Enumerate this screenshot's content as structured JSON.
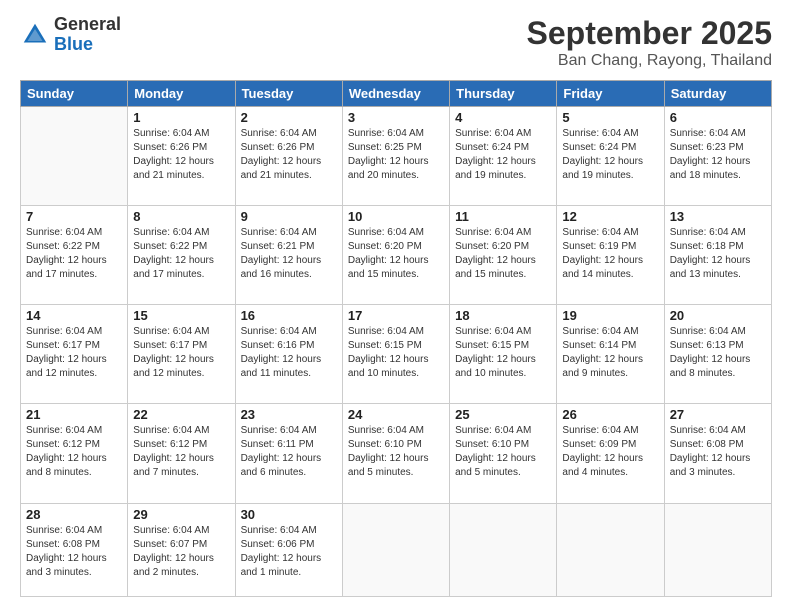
{
  "header": {
    "logo_general": "General",
    "logo_blue": "Blue",
    "title": "September 2025",
    "subtitle": "Ban Chang, Rayong, Thailand"
  },
  "weekdays": [
    "Sunday",
    "Monday",
    "Tuesday",
    "Wednesday",
    "Thursday",
    "Friday",
    "Saturday"
  ],
  "weeks": [
    [
      {
        "day": "",
        "info": ""
      },
      {
        "day": "1",
        "info": "Sunrise: 6:04 AM\nSunset: 6:26 PM\nDaylight: 12 hours\nand 21 minutes."
      },
      {
        "day": "2",
        "info": "Sunrise: 6:04 AM\nSunset: 6:26 PM\nDaylight: 12 hours\nand 21 minutes."
      },
      {
        "day": "3",
        "info": "Sunrise: 6:04 AM\nSunset: 6:25 PM\nDaylight: 12 hours\nand 20 minutes."
      },
      {
        "day": "4",
        "info": "Sunrise: 6:04 AM\nSunset: 6:24 PM\nDaylight: 12 hours\nand 19 minutes."
      },
      {
        "day": "5",
        "info": "Sunrise: 6:04 AM\nSunset: 6:24 PM\nDaylight: 12 hours\nand 19 minutes."
      },
      {
        "day": "6",
        "info": "Sunrise: 6:04 AM\nSunset: 6:23 PM\nDaylight: 12 hours\nand 18 minutes."
      }
    ],
    [
      {
        "day": "7",
        "info": "Sunrise: 6:04 AM\nSunset: 6:22 PM\nDaylight: 12 hours\nand 17 minutes."
      },
      {
        "day": "8",
        "info": "Sunrise: 6:04 AM\nSunset: 6:22 PM\nDaylight: 12 hours\nand 17 minutes."
      },
      {
        "day": "9",
        "info": "Sunrise: 6:04 AM\nSunset: 6:21 PM\nDaylight: 12 hours\nand 16 minutes."
      },
      {
        "day": "10",
        "info": "Sunrise: 6:04 AM\nSunset: 6:20 PM\nDaylight: 12 hours\nand 15 minutes."
      },
      {
        "day": "11",
        "info": "Sunrise: 6:04 AM\nSunset: 6:20 PM\nDaylight: 12 hours\nand 15 minutes."
      },
      {
        "day": "12",
        "info": "Sunrise: 6:04 AM\nSunset: 6:19 PM\nDaylight: 12 hours\nand 14 minutes."
      },
      {
        "day": "13",
        "info": "Sunrise: 6:04 AM\nSunset: 6:18 PM\nDaylight: 12 hours\nand 13 minutes."
      }
    ],
    [
      {
        "day": "14",
        "info": "Sunrise: 6:04 AM\nSunset: 6:17 PM\nDaylight: 12 hours\nand 12 minutes."
      },
      {
        "day": "15",
        "info": "Sunrise: 6:04 AM\nSunset: 6:17 PM\nDaylight: 12 hours\nand 12 minutes."
      },
      {
        "day": "16",
        "info": "Sunrise: 6:04 AM\nSunset: 6:16 PM\nDaylight: 12 hours\nand 11 minutes."
      },
      {
        "day": "17",
        "info": "Sunrise: 6:04 AM\nSunset: 6:15 PM\nDaylight: 12 hours\nand 10 minutes."
      },
      {
        "day": "18",
        "info": "Sunrise: 6:04 AM\nSunset: 6:15 PM\nDaylight: 12 hours\nand 10 minutes."
      },
      {
        "day": "19",
        "info": "Sunrise: 6:04 AM\nSunset: 6:14 PM\nDaylight: 12 hours\nand 9 minutes."
      },
      {
        "day": "20",
        "info": "Sunrise: 6:04 AM\nSunset: 6:13 PM\nDaylight: 12 hours\nand 8 minutes."
      }
    ],
    [
      {
        "day": "21",
        "info": "Sunrise: 6:04 AM\nSunset: 6:12 PM\nDaylight: 12 hours\nand 8 minutes."
      },
      {
        "day": "22",
        "info": "Sunrise: 6:04 AM\nSunset: 6:12 PM\nDaylight: 12 hours\nand 7 minutes."
      },
      {
        "day": "23",
        "info": "Sunrise: 6:04 AM\nSunset: 6:11 PM\nDaylight: 12 hours\nand 6 minutes."
      },
      {
        "day": "24",
        "info": "Sunrise: 6:04 AM\nSunset: 6:10 PM\nDaylight: 12 hours\nand 5 minutes."
      },
      {
        "day": "25",
        "info": "Sunrise: 6:04 AM\nSunset: 6:10 PM\nDaylight: 12 hours\nand 5 minutes."
      },
      {
        "day": "26",
        "info": "Sunrise: 6:04 AM\nSunset: 6:09 PM\nDaylight: 12 hours\nand 4 minutes."
      },
      {
        "day": "27",
        "info": "Sunrise: 6:04 AM\nSunset: 6:08 PM\nDaylight: 12 hours\nand 3 minutes."
      }
    ],
    [
      {
        "day": "28",
        "info": "Sunrise: 6:04 AM\nSunset: 6:08 PM\nDaylight: 12 hours\nand 3 minutes."
      },
      {
        "day": "29",
        "info": "Sunrise: 6:04 AM\nSunset: 6:07 PM\nDaylight: 12 hours\nand 2 minutes."
      },
      {
        "day": "30",
        "info": "Sunrise: 6:04 AM\nSunset: 6:06 PM\nDaylight: 12 hours\nand 1 minute."
      },
      {
        "day": "",
        "info": ""
      },
      {
        "day": "",
        "info": ""
      },
      {
        "day": "",
        "info": ""
      },
      {
        "day": "",
        "info": ""
      }
    ]
  ]
}
